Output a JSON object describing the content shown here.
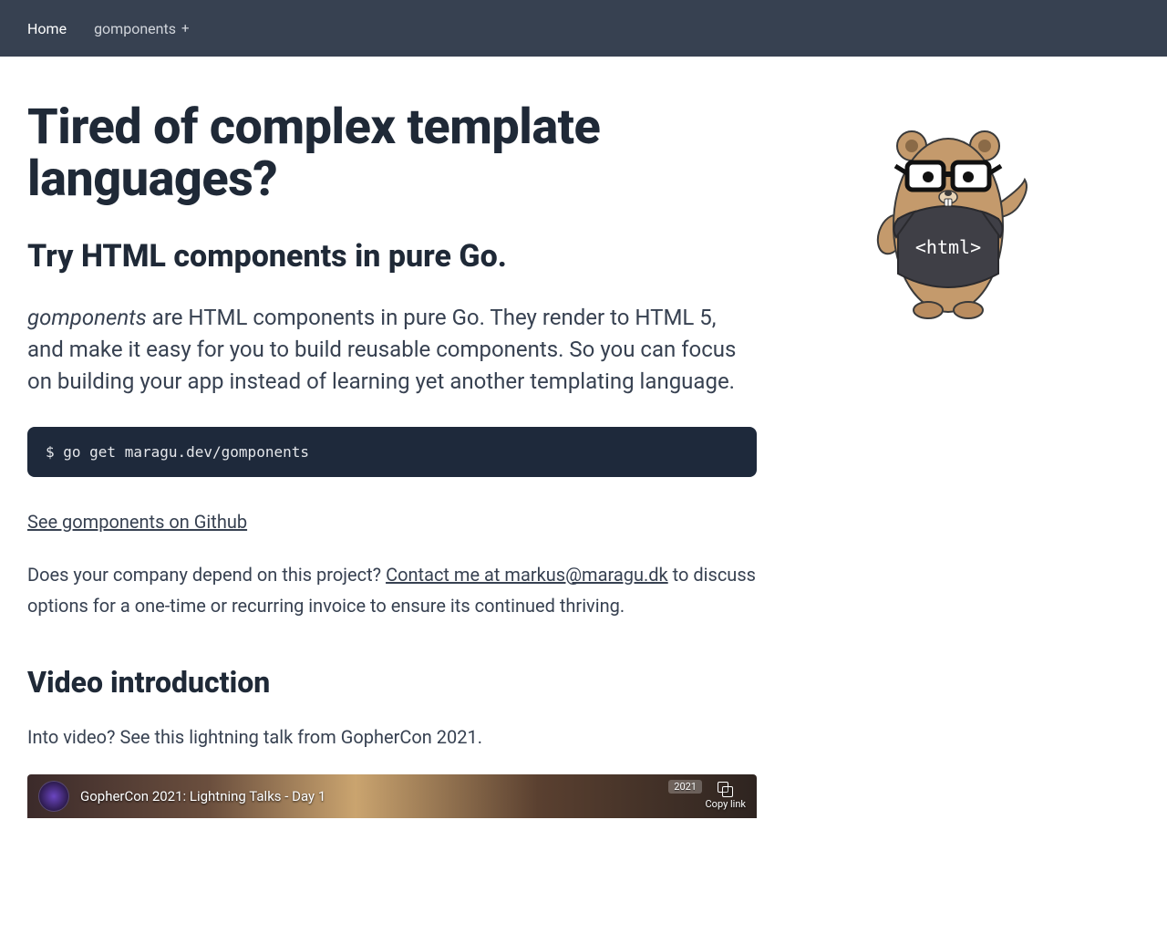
{
  "nav": {
    "home": "Home",
    "dropdown_label": "gomponents",
    "dropdown_glyph": "+"
  },
  "hero": {
    "title": "Tired of complex template languages?",
    "subtitle": "Try HTML components in pure Go.",
    "lead_em": "gomponents",
    "lead_rest": " are HTML components in pure Go. They render to HTML 5, and make it easy for you to build reusable components. So you can focus on building your app instead of learning yet another templating language."
  },
  "code": {
    "install": "$ go get maragu.dev/gomponents"
  },
  "links": {
    "github": "See gomponents on Github",
    "contact_pre": "Does your company depend on this project? ",
    "contact_link": "Contact me at markus@maragu.dk",
    "contact_post": " to discuss options for a one-time or recurring invoice to ensure its continued thriving."
  },
  "video": {
    "section_title": "Video introduction",
    "intro": "Into video? See this lightning talk from GopherCon 2021.",
    "title": "GopherCon 2021: Lightning Talks - Day 1",
    "year_badge": "2021",
    "copy_label": "Copy link"
  },
  "mascot": {
    "shirt_text": "<html>"
  }
}
